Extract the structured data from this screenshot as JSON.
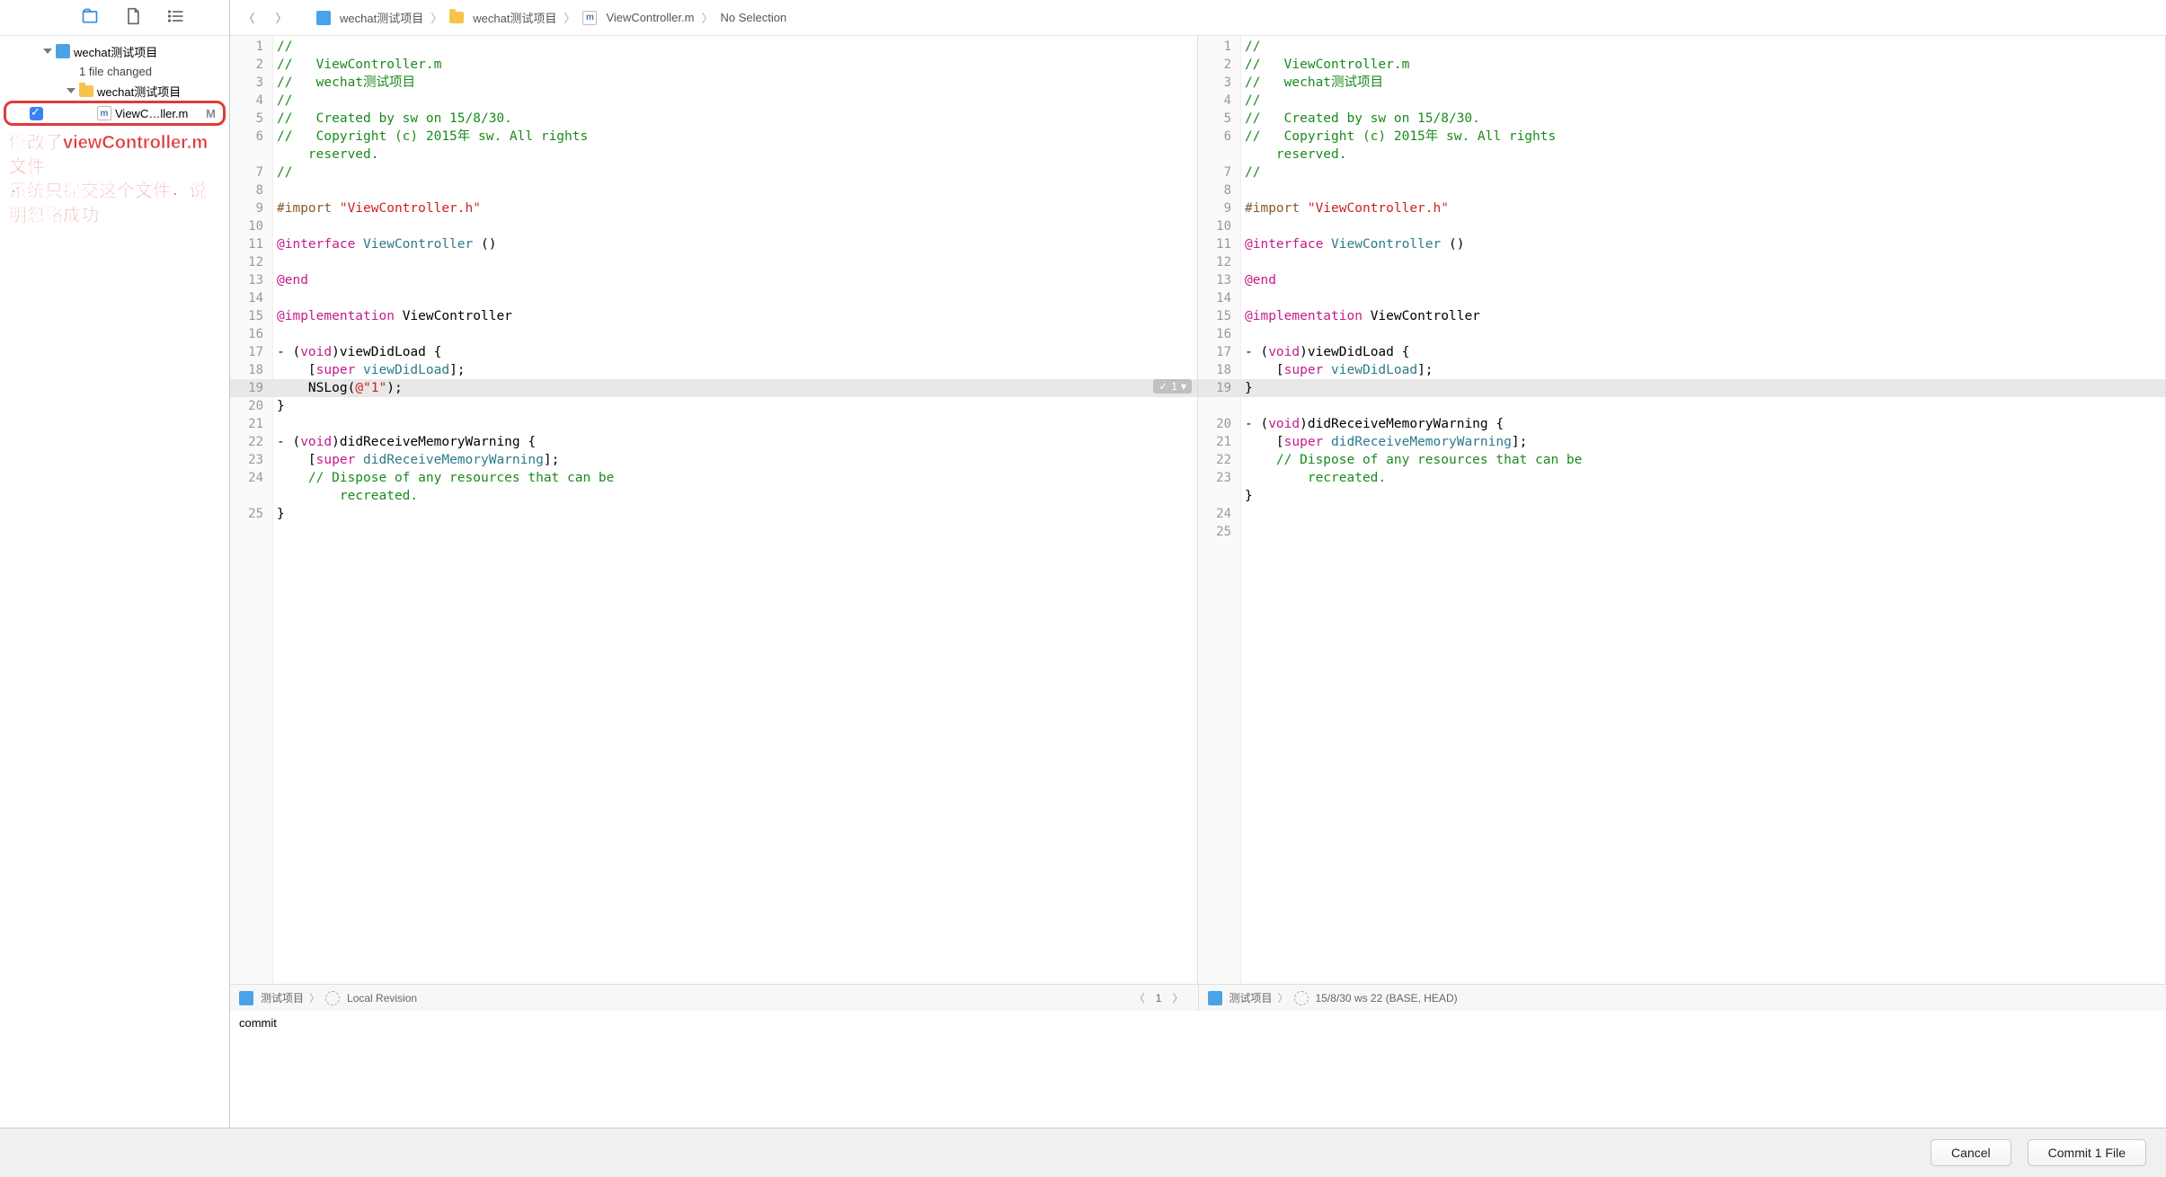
{
  "sidebar": {
    "project": "wechat测试项目",
    "changed_text": "1 file changed",
    "folder": "wechat测试项目",
    "file": "ViewC…ller.m",
    "file_status": "M"
  },
  "annotation": {
    "line1": "修改了viewController.m文件",
    "line2": "系统只提交这个文件，说明忽略成功"
  },
  "crumb": {
    "project": "wechat测试项目",
    "folder": "wechat测试项目",
    "file": "ViewController.m",
    "sel": "No Selection"
  },
  "left_gutter": [
    "1",
    "2",
    "3",
    "4",
    "5",
    "6",
    "",
    "7",
    "8",
    "9",
    "10",
    "11",
    "12",
    "13",
    "14",
    "15",
    "16",
    "17",
    "18",
    "19",
    "20",
    "21",
    "22",
    "23",
    "24",
    "",
    "25"
  ],
  "right_gutter": [
    "1",
    "2",
    "3",
    "4",
    "5",
    "6",
    "",
    "7",
    "8",
    "9",
    "10",
    "11",
    "12",
    "13",
    "14",
    "15",
    "16",
    "17",
    "18",
    "19",
    "",
    "20",
    "21",
    "22",
    "23",
    "",
    "24",
    "25"
  ],
  "left_code": [
    [
      [
        "//",
        "comment"
      ]
    ],
    [
      [
        "//   ViewController.m",
        "comment"
      ]
    ],
    [
      [
        "//   wechat测试项目",
        "comment"
      ]
    ],
    [
      [
        "//",
        "comment"
      ]
    ],
    [
      [
        "//   Created by sw on 15/8/30.",
        "comment"
      ]
    ],
    [
      [
        "//   Copyright (c) 2015年 sw. All rights",
        "comment"
      ]
    ],
    [
      [
        "    reserved.",
        "comment"
      ]
    ],
    [
      [
        "//",
        "comment"
      ]
    ],
    [
      [
        "",
        ""
      ]
    ],
    [
      [
        "#import ",
        "pre"
      ],
      [
        "\"ViewController.h\"",
        "string"
      ]
    ],
    [
      [
        "",
        ""
      ]
    ],
    [
      [
        "@interface ",
        "keyword"
      ],
      [
        "ViewController ",
        "type"
      ],
      [
        "()",
        ""
      ]
    ],
    [
      [
        "",
        ""
      ]
    ],
    [
      [
        "@end",
        "keyword"
      ]
    ],
    [
      [
        "",
        ""
      ]
    ],
    [
      [
        "@implementation ",
        "keyword"
      ],
      [
        "ViewController",
        ""
      ]
    ],
    [
      [
        "",
        ""
      ]
    ],
    [
      [
        "- (",
        ""
      ],
      [
        "void",
        "keyword"
      ],
      [
        ")viewDidLoad {",
        ""
      ]
    ],
    [
      [
        "    [",
        ""
      ],
      [
        "super",
        "super"
      ],
      [
        " ",
        ""
      ],
      [
        "viewDidLoad",
        "type"
      ],
      [
        "];",
        ""
      ]
    ],
    [
      [
        "    NSLog(",
        ""
      ],
      [
        "@\"1\"",
        "string"
      ],
      [
        ");",
        ""
      ]
    ],
    [
      [
        "}",
        ""
      ]
    ],
    [
      [
        "",
        ""
      ]
    ],
    [
      [
        "- (",
        ""
      ],
      [
        "void",
        "keyword"
      ],
      [
        ")didReceiveMemoryWarning {",
        ""
      ]
    ],
    [
      [
        "    [",
        ""
      ],
      [
        "super",
        "super"
      ],
      [
        " ",
        ""
      ],
      [
        "didReceiveMemoryWarning",
        "type"
      ],
      [
        "];",
        ""
      ]
    ],
    [
      [
        "    ",
        ""
      ],
      [
        "// Dispose of any resources that can be",
        "comment"
      ]
    ],
    [
      [
        "        recreated.",
        "comment"
      ]
    ],
    [
      [
        "}",
        ""
      ]
    ]
  ],
  "right_code": [
    [
      [
        "//",
        "comment"
      ]
    ],
    [
      [
        "//   ViewController.m",
        "comment"
      ]
    ],
    [
      [
        "//   wechat测试项目",
        "comment"
      ]
    ],
    [
      [
        "//",
        "comment"
      ]
    ],
    [
      [
        "//   Created by sw on 15/8/30.",
        "comment"
      ]
    ],
    [
      [
        "//   Copyright (c) 2015年 sw. All rights",
        "comment"
      ]
    ],
    [
      [
        "    reserved.",
        "comment"
      ]
    ],
    [
      [
        "//",
        "comment"
      ]
    ],
    [
      [
        "",
        ""
      ]
    ],
    [
      [
        "#import ",
        "pre"
      ],
      [
        "\"ViewController.h\"",
        "string"
      ]
    ],
    [
      [
        "",
        ""
      ]
    ],
    [
      [
        "@interface ",
        "keyword"
      ],
      [
        "ViewController ",
        "type"
      ],
      [
        "()",
        ""
      ]
    ],
    [
      [
        "",
        ""
      ]
    ],
    [
      [
        "@end",
        "keyword"
      ]
    ],
    [
      [
        "",
        ""
      ]
    ],
    [
      [
        "@implementation ",
        "keyword"
      ],
      [
        "ViewController",
        ""
      ]
    ],
    [
      [
        "",
        ""
      ]
    ],
    [
      [
        "- (",
        ""
      ],
      [
        "void",
        "keyword"
      ],
      [
        ")viewDidLoad {",
        ""
      ]
    ],
    [
      [
        "    [",
        ""
      ],
      [
        "super",
        "super"
      ],
      [
        " ",
        ""
      ],
      [
        "viewDidLoad",
        "type"
      ],
      [
        "];",
        ""
      ]
    ],
    [
      [
        "}",
        ""
      ]
    ],
    [
      [
        "",
        ""
      ]
    ],
    [
      [
        "- (",
        ""
      ],
      [
        "void",
        "keyword"
      ],
      [
        ")didReceiveMemoryWarning {",
        ""
      ]
    ],
    [
      [
        "    [",
        ""
      ],
      [
        "super",
        "super"
      ],
      [
        " ",
        ""
      ],
      [
        "didReceiveMemoryWarning",
        "type"
      ],
      [
        "];",
        ""
      ]
    ],
    [
      [
        "    ",
        ""
      ],
      [
        "// Dispose of any resources that can be",
        "comment"
      ]
    ],
    [
      [
        "        recreated.",
        "comment"
      ]
    ],
    [
      [
        "}",
        ""
      ]
    ],
    [
      [
        "",
        ""
      ]
    ]
  ],
  "diff_badge": {
    "count": "1"
  },
  "btm_left": {
    "proj": "测试项目",
    "rev": "Local Revision"
  },
  "btm_right": {
    "proj": "测试项目",
    "rev": "15/8/30  ws  22 (BASE, HEAD)"
  },
  "pager": {
    "page": "1"
  },
  "commit": {
    "msg": "commit"
  },
  "footer": {
    "cancel": "Cancel",
    "commit": "Commit 1 File"
  }
}
